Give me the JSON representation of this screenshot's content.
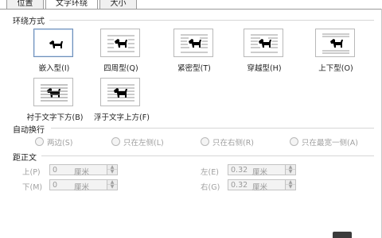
{
  "tabs": [
    {
      "label": "位置"
    },
    {
      "label": "文字环绕"
    },
    {
      "label": "大小"
    }
  ],
  "wrap_section": {
    "title": "环绕方式",
    "options": [
      {
        "label": "嵌入型(I)",
        "icon": "inline-with-text-icon"
      },
      {
        "label": "四周型(Q)",
        "icon": "square-wrap-icon"
      },
      {
        "label": "紧密型(T)",
        "icon": "tight-wrap-icon"
      },
      {
        "label": "穿越型(H)",
        "icon": "through-wrap-icon"
      },
      {
        "label": "上下型(O)",
        "icon": "top-bottom-wrap-icon"
      },
      {
        "label": "衬于文字下方(B)",
        "icon": "behind-text-icon"
      },
      {
        "label": "浮于文字上方(F)",
        "icon": "in-front-of-text-icon"
      }
    ],
    "selected": "嵌入型(I)"
  },
  "auto_wrap": {
    "title": "自动换行",
    "options": [
      {
        "label": "两边(S)"
      },
      {
        "label": "只在左侧(L)"
      },
      {
        "label": "只在右侧(R)"
      },
      {
        "label": "只在最宽一侧(A)"
      }
    ]
  },
  "distance": {
    "title": "距正文",
    "top": {
      "label": "上(P)",
      "value": "0",
      "unit": "厘米"
    },
    "bottom": {
      "label": "下(M)",
      "value": "0",
      "unit": "厘米"
    },
    "left": {
      "label": "左(E)",
      "value": "0.32",
      "unit": "厘米"
    },
    "right": {
      "label": "右(G)",
      "value": "0.32",
      "unit": "厘米"
    }
  },
  "colors": {
    "disabled_text": "#a0a0a0",
    "selected_border": "#6f8fb8",
    "icon_lines": "#9a9a9a",
    "icon_dog": "#000000"
  }
}
